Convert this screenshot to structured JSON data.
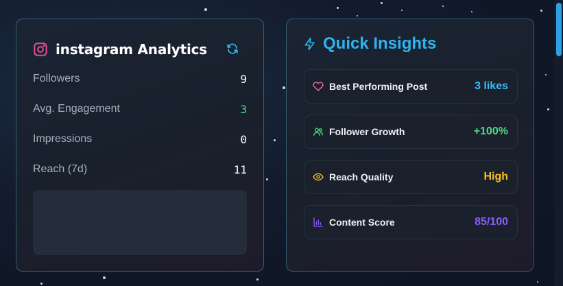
{
  "instagram_card": {
    "title": "instagram Analytics",
    "metrics": [
      {
        "label": "Followers",
        "value": "9",
        "color": "#ffffff"
      },
      {
        "label": "Avg. Engagement",
        "value": "3",
        "color": "#4ade80"
      },
      {
        "label": "Impressions",
        "value": "0",
        "color": "#ffffff"
      },
      {
        "label": "Reach (7d)",
        "value": "11",
        "color": "#ffffff"
      }
    ]
  },
  "insights_card": {
    "title": "Quick Insights",
    "items": [
      {
        "label": "Best Performing Post",
        "value": "3 likes",
        "icon": "heart-icon",
        "icon_color": "#f472b6",
        "value_color": "#38bdf8"
      },
      {
        "label": "Follower Growth",
        "value": "+100%",
        "icon": "users-icon",
        "icon_color": "#4ade80",
        "value_color": "#4ade80"
      },
      {
        "label": "Reach Quality",
        "value": "High",
        "icon": "eye-icon",
        "icon_color": "#fbbf24",
        "value_color": "#fbbf24"
      },
      {
        "label": "Content Score",
        "value": "85/100",
        "icon": "bar-chart-icon",
        "icon_color": "#8b5cf6",
        "value_color": "#8b5cf6"
      }
    ]
  },
  "colors": {
    "accent": "#2eb3f0",
    "instagram": "#e04f8f",
    "card_border": "#50aac8"
  }
}
